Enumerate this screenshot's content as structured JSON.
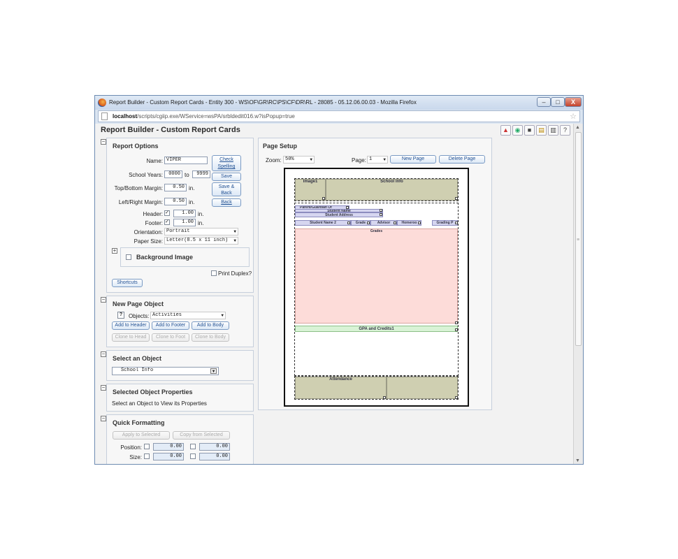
{
  "window": {
    "title": "Report Builder - Custom Report Cards - Entity 300 - WS\\OF\\GR\\RC\\PS\\CF\\DR\\RL - 28085 - 05.12.06.00.03 - Mozilla Firefox",
    "url_host": "localhost",
    "url_path": "/scripts/cgiip.exe/WService=wsPA/srbldedit016.w?isPopup=true",
    "min": "–",
    "max": "□",
    "close": "X"
  },
  "app": {
    "title": "Report Builder - Custom Report Cards"
  },
  "toolbar": {
    "icons": [
      "alert-icon",
      "globe-icon",
      "camera-icon",
      "clipboard-icon",
      "print-icon",
      "help-icon"
    ],
    "help": "?"
  },
  "report_options": {
    "title": "Report Options",
    "name_label": "Name:",
    "name_value": "VIPER",
    "check_spelling": "Check Spelling",
    "school_years_label": "School Years:",
    "year_from": "0000",
    "to_label": "to",
    "year_to": "9999",
    "save": "Save",
    "tb_margin_label": "Top/Bottom Margin:",
    "tb_margin_value": "0.50",
    "save_back": "Save & Back",
    "lr_margin_label": "Left/Right Margin:",
    "lr_margin_value": "0.50",
    "back": "Back",
    "unit": "in.",
    "header_label": "Header:",
    "header_value": "1.00",
    "footer_label": "Footer:",
    "footer_value": "1.00",
    "orientation_label": "Orientation:",
    "orientation_value": "Portrait",
    "paper_label": "Paper Size:",
    "paper_value": "Letter(8.5 x 11 inch)",
    "background_image": "Background Image",
    "print_duplex": "Print Duplex?",
    "shortcuts": "Shortcuts",
    "check": "✓"
  },
  "new_page_object": {
    "title": "New Page Object",
    "help": "?",
    "objects_label": "Objects:",
    "objects_value": "Activities",
    "add_header": "Add to Header",
    "add_footer": "Add to Footer",
    "add_body": "Add to Body",
    "clone_head": "Clone to Head",
    "clone_foot": "Clone to Foot",
    "clone_body": "Clone to Body"
  },
  "select_object": {
    "title": "Select an Object",
    "value": "School Info"
  },
  "selected_props": {
    "title": "Selected Object Properties",
    "hint": "Select an Object to View its Properties"
  },
  "quick_formatting": {
    "title": "Quick Formatting",
    "apply": "Apply to Selected",
    "copy": "Copy from Selected",
    "position_label": "Position:",
    "size_label": "Size:",
    "pos_x": "0.00",
    "pos_y": "0.00",
    "size_w": "0.00",
    "size_h": "0.00"
  },
  "page_setup": {
    "title": "Page Setup",
    "zoom_label": "Zoom:",
    "zoom_value": "50%",
    "page_label": "Page:",
    "page_value": "1",
    "new_page": "New Page",
    "delete_page": "Delete Page",
    "sections": {
      "image1": "Image1",
      "school_info": "School Info",
      "parent": "Parent/Guardian Of",
      "student_name": "Student Name",
      "student_address": "Student Address",
      "student_name2": "Student Name 2",
      "grade": "Grade",
      "advisor": "Advisor",
      "homeroom": "Homeroo",
      "grading": "Grading P",
      "grades": "Grades",
      "gpa": "GPA and Credits1",
      "attendance": "Attendance"
    },
    "colors": {
      "olive": "#cfcfb1",
      "pink": "#fddcd9",
      "green": "#d9f3d6",
      "lavender": "#d6d6f0"
    }
  },
  "sb": {
    "up": "▲",
    "down": "▼",
    "grip": "≡"
  },
  "collapse": {
    "minus": "−",
    "plus": "+"
  },
  "dropdown_arrow": "▼"
}
